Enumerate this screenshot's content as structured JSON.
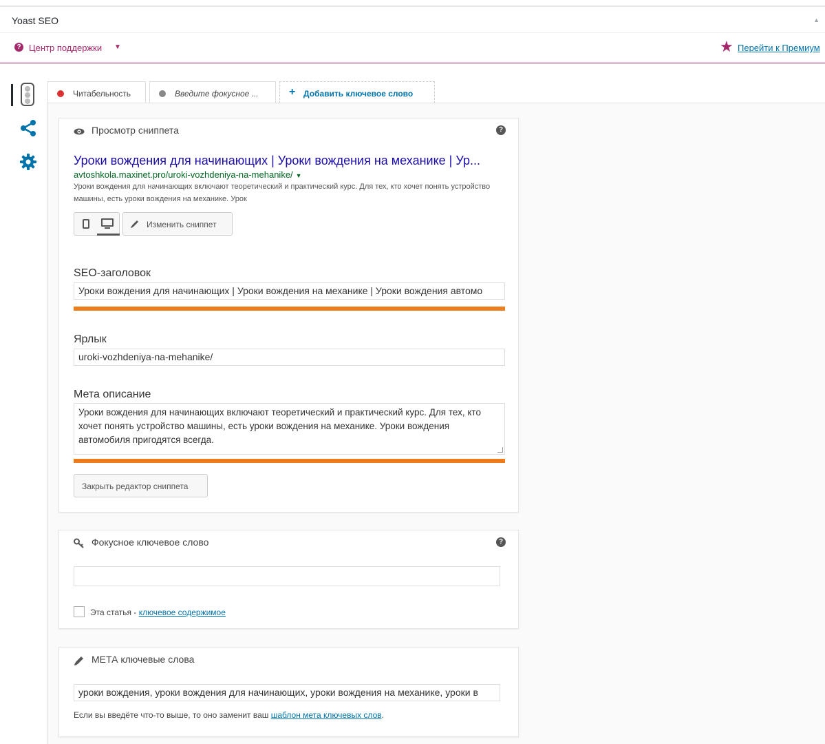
{
  "metabox": {
    "title": "Yoast SEO"
  },
  "help_center": {
    "label": "Центр поддержки",
    "caret": "▼"
  },
  "premium": {
    "label": "Перейти к Премиум"
  },
  "tabs": {
    "readability": "Читабельность",
    "focus_placeholder": "Введите фокусное ...",
    "add_keyword": "Добавить ключевое слово",
    "add_symbol": "+"
  },
  "snippet": {
    "heading": "Просмотр сниппета",
    "help_symbol": "?",
    "preview_title": "Уроки вождения для начинающих | Уроки вождения на механике | Ур...",
    "preview_url": "avtoshkola.maxinet.pro/uroki-vozhdeniya-na-mehanike/",
    "preview_url_caret": "▼",
    "preview_description": "Уроки вождения для начинающих включают теоретический и практический курс. Для тех, кто хочет понять устройство машины, есть уроки вождения на механике. Урок",
    "edit_button": "Изменить сниппет",
    "seo_title_label": "SEO-заголовок",
    "seo_title_value": "Уроки вождения для начинающих | Уроки вождения на механике | Уроки вождения автомо",
    "seo_title_progress": 1.0,
    "slug_label": "Ярлык",
    "slug_value": "uroki-vozhdeniya-na-mehanike/",
    "meta_desc_label": "Мета описание",
    "meta_desc_value": "Уроки вождения для начинающих включают теоретический и практический курс. Для тех, кто хочет понять устройство машины, есть уроки вождения на механике. Уроки вождения автомобиля пригодятся всегда.",
    "meta_desc_progress": 1.0,
    "close_button": "Закрыть редактор сниппета"
  },
  "focus_keyword": {
    "heading": "Фокусное ключевое слово",
    "help_symbol": "?",
    "value": "",
    "cornerstone_prefix": "Эта статья - ",
    "cornerstone_link": "ключевое содержимое",
    "cornerstone_checked": false
  },
  "meta_keywords": {
    "heading": "МЕТА ключевые слова",
    "value": "уроки вождения, уроки вождения для начинающих, уроки вождения на механике, уроки в",
    "note_prefix": "Если вы введёте что-то выше, то оно заменит ваш ",
    "note_link": "шаблон мета ключевых слов",
    "note_suffix": "."
  },
  "colors": {
    "brand": "#a4286a",
    "link": "#0073aa",
    "progress_warning": "#ee7c1b",
    "readability_dot": "#dc3232",
    "focus_dot": "#888888",
    "serp_title": "#1a0dab",
    "serp_url": "#006621"
  },
  "icons": {
    "help": "question-circle-icon",
    "premium": "star-icon",
    "sidebar": [
      "traffic-light-icon",
      "share-icon",
      "gear-icon"
    ],
    "snippet": "eye-icon",
    "focus_keyword": "key-icon",
    "meta_keywords": "pencil-icon",
    "mode_mobile": "mobile-icon",
    "mode_desktop": "desktop-icon",
    "edit": "pencil-icon"
  }
}
